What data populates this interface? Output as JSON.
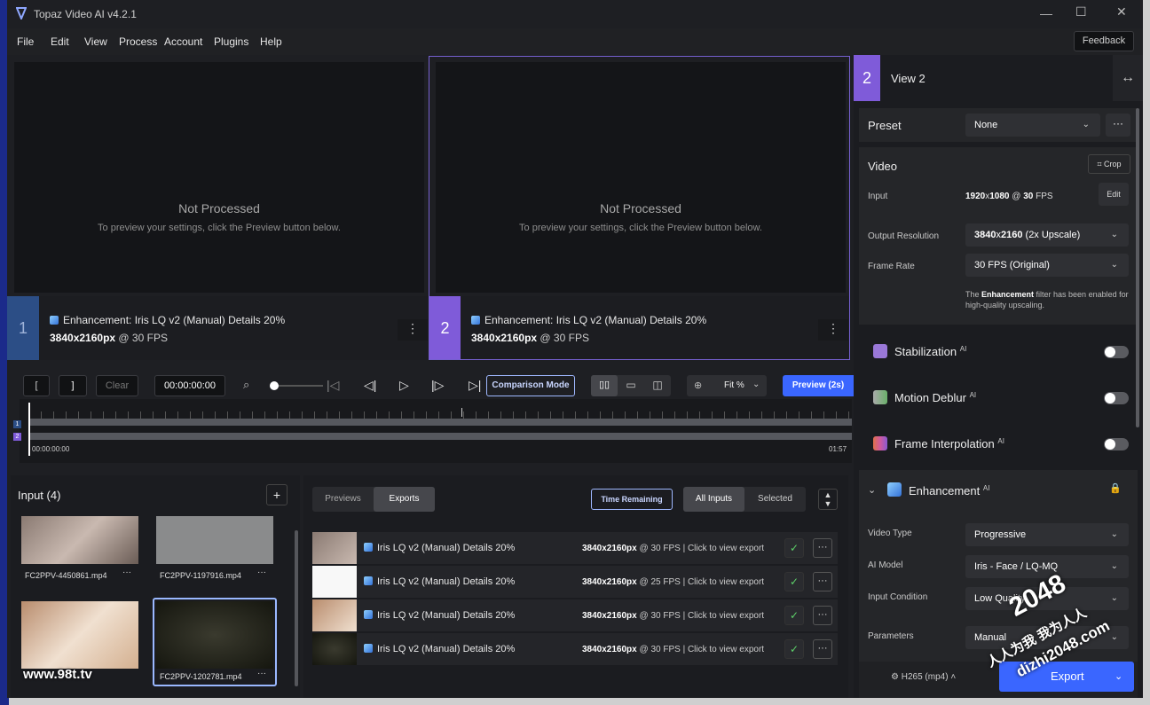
{
  "window": {
    "title": "Topaz Video AI  v4.2.1",
    "feedback": "Feedback"
  },
  "menu": [
    "File",
    "Edit",
    "View",
    "Process",
    "Account",
    "Plugins",
    "Help"
  ],
  "viewers": [
    {
      "number": "1",
      "title": "Not Processed",
      "subtitle": "To preview your settings, click the Preview button below.",
      "desc": "Enhancement: Iris LQ v2 (Manual) Details 20%",
      "res": "3840x2160px",
      "fps": " @ 30 FPS"
    },
    {
      "number": "2",
      "title": "Not Processed",
      "subtitle": "To preview your settings, click the Preview button below.",
      "desc": "Enhancement: Iris LQ v2 (Manual) Details 20%",
      "res": "3840x2160px",
      "fps": " @ 30 FPS"
    }
  ],
  "controls": {
    "in_mark": "[",
    "out_mark": "]",
    "clear": "Clear",
    "timecode": "00:00:00:00",
    "comparison": "Comparison Mode",
    "zoom": "Fit %",
    "preview": "Preview (2s)"
  },
  "timeline": {
    "start": "00:00:00:00",
    "end": "01:57",
    "track1": "1",
    "track2": "2"
  },
  "right": {
    "view_number": "2",
    "view_title": "View 2",
    "preset_label": "Preset",
    "preset_value": "None",
    "video_label": "Video",
    "crop": "Crop",
    "input_label": "Input",
    "input_w": "1920",
    "input_x": "x",
    "input_h": "1080",
    "input_at": " @ ",
    "input_fps": "30",
    "input_unit": " FPS",
    "edit": "Edit",
    "output_label": "Output Resolution",
    "output_res": "3840",
    "output_x": "x",
    "output_h": "2160",
    "output_note": " (2x Upscale)",
    "framerate_label": "Frame Rate",
    "framerate_value": "30 FPS (Original)",
    "note_pre": "The ",
    "note_bold": "Enhancement",
    "note_post": " filter has been enabled for high-quality upscaling.",
    "stabilization": "Stabilization",
    "motion_deblur": "Motion Deblur",
    "frame_interp": "Frame Interpolation",
    "ai": "AI",
    "enhancement": "Enhancement",
    "video_type_label": "Video Type",
    "video_type": "Progressive",
    "ai_model_label": "AI Model",
    "ai_model": "Iris - Face / LQ-MQ",
    "input_cond_label": "Input Condition",
    "input_cond": "Low Quality",
    "params_label": "Parameters",
    "params": "Manual",
    "codec": "H265 (mp4)",
    "export": "Export"
  },
  "input_panel": {
    "title": "Input (4)",
    "add": "+",
    "files": [
      "FC2PPV-4450861.mp4",
      "FC2PPV-1197916.mp4",
      "FC2PPV-1202781.mp4"
    ]
  },
  "export_panel": {
    "tabs": [
      "Previews",
      "Exports"
    ],
    "time_remaining": "Time Remaining",
    "scope": [
      "All Inputs",
      "Selected"
    ],
    "rows": [
      {
        "title": "Iris LQ v2 (Manual) Details 20%",
        "res": "3840x2160px",
        "fps": " @ 30 FPS",
        "link": "  |  Click to view export"
      },
      {
        "title": "Iris LQ v2 (Manual) Details 20%",
        "res": "3840x2160px",
        "fps": " @ 25 FPS",
        "link": "  |  Click to view export"
      },
      {
        "title": "Iris LQ v2 (Manual) Details 20%",
        "res": "3840x2160px",
        "fps": " @ 30 FPS",
        "link": "  |  Click to view export"
      },
      {
        "title": "Iris LQ v2 (Manual) Details 20%",
        "res": "3840x2160px",
        "fps": " @ 30 FPS",
        "link": "  |  Click to view export"
      }
    ]
  },
  "watermarks": {
    "site": "www.98t.tv",
    "num": "2048",
    "cn": "人人为我 我为人人",
    "url": "dizhi2048.com"
  },
  "colors": {
    "accent": "#6a4fe0",
    "blue": "#3a66ff",
    "view1": "#2c4e86",
    "view2": "#7f5bd9"
  }
}
